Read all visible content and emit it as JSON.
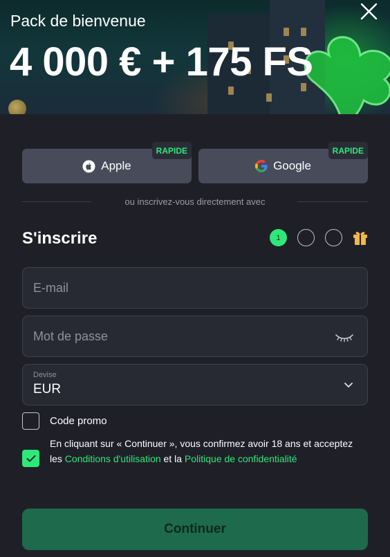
{
  "banner": {
    "subtitle": "Pack de bienvenue",
    "title": "4 000 € + 175 FS"
  },
  "social": {
    "apple_label": "Apple",
    "google_label": "Google",
    "badge": "RAPIDE",
    "divider_text": "ou inscrivez-vous directement avec"
  },
  "form": {
    "heading": "S'inscrire",
    "step_current": "1",
    "email_placeholder": "E-mail",
    "password_placeholder": "Mot de passe",
    "currency_label": "Devise",
    "currency_value": "EUR",
    "promo_label": "Code promo",
    "terms_prefix": "En cliquant sur « Continuer », vous confirmez avoir 18 ans et acceptez les ",
    "terms_link1": "Conditions d'utilisation",
    "terms_middle": " et la ",
    "terms_link2": "Politique de confidentialité",
    "continue_label": "Continuer"
  },
  "colors": {
    "accent": "#2ee87a",
    "background": "#1f2027",
    "field_bg": "#272a33",
    "button_bg": "#484c5a",
    "continue_bg": "#1d6b4c"
  },
  "icons": [
    "close-icon",
    "apple-icon",
    "google-icon",
    "eye-closed-icon",
    "chevron-down-icon",
    "gift-icon",
    "checkmark-icon"
  ]
}
